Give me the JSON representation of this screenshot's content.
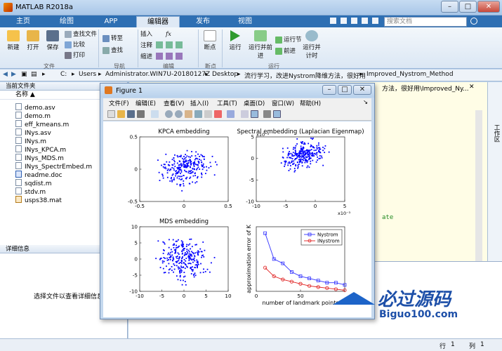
{
  "window": {
    "title": "MATLAB R2018a",
    "buttons": [
      "–",
      "□",
      "✕"
    ]
  },
  "ribbon": {
    "tabs": [
      "主页",
      "绘图",
      "APP",
      "编辑器",
      "发布",
      "视图"
    ],
    "active_tab": "编辑器",
    "search_placeholder": "搜索文档",
    "file_group": {
      "label": "文件",
      "new": "新建",
      "open": "打开",
      "save": "保存",
      "find_files": "查找文件",
      "compare": "比较",
      "print": "打印"
    },
    "nav_group": {
      "label": "导航",
      "goto": "转至",
      "find": "查找"
    },
    "edit_group": {
      "label": "编辑",
      "insert": "插入",
      "comment": "注释",
      "indent": "缩进",
      "fx": "fx"
    },
    "breakpoint_group": {
      "label": "断点",
      "breakpoints": "断点"
    },
    "run_group": {
      "label": "运行",
      "run": "运行",
      "run_advance": "运行并前进",
      "run_section": "运行节",
      "advance": "前进",
      "run_time": "运行并计时"
    }
  },
  "address": {
    "path": [
      "C:",
      "Users",
      "Administrator.WIN7U-20180127Z",
      "Desktop",
      "流行学习，改进Nystrom降维方法，很好用",
      "Improved_Nystrom_Method"
    ]
  },
  "current_folder": {
    "title": "当前文件夹",
    "column": "名称",
    "files": [
      {
        "name": "demo.asv"
      },
      {
        "name": "demo.m"
      },
      {
        "name": "eff_kmeans.m"
      },
      {
        "name": "INys.asv"
      },
      {
        "name": "INys.m"
      },
      {
        "name": "INys_KPCA.m"
      },
      {
        "name": "INys_MDS.m"
      },
      {
        "name": "INys_SpectrEmbed.m"
      },
      {
        "name": "readme.doc"
      },
      {
        "name": "sqdist.m"
      },
      {
        "name": "stdv.m"
      },
      {
        "name": "usps38.mat"
      }
    ],
    "details_title": "详细信息",
    "details_hint": "选择文件以查看详细信息"
  },
  "editor": {
    "tab_label": "方法，很好用\\Improved_Ny...",
    "side_label": "工作区",
    "code_fragment": "ate"
  },
  "status": {
    "row_label": "行",
    "row": "1",
    "col_label": "列",
    "col": "1"
  },
  "figure": {
    "title": "Figure 1",
    "menu": [
      "文件(F)",
      "编辑(E)",
      "查看(V)",
      "插入(I)",
      "工具(T)",
      "桌面(D)",
      "窗口(W)",
      "帮助(H)"
    ]
  },
  "chart_data": [
    {
      "type": "scatter",
      "title": "KPCA embedding",
      "xlim": [
        -0.5,
        0.5
      ],
      "ylim": [
        -0.5,
        0.5
      ],
      "xticks": [
        "-0.5",
        "0",
        "0.5"
      ],
      "yticks": [
        "0.5",
        "0",
        "-0.5"
      ],
      "color": "#0000ff"
    },
    {
      "type": "scatter",
      "title": "Spectral embedding (Laplacian Eigenmap)",
      "xlim": [
        -10,
        5
      ],
      "ylim": [
        -10,
        5
      ],
      "xticks": [
        "-10",
        "-5",
        "0",
        "5"
      ],
      "yticks": [
        "5",
        "0",
        "-5",
        "-10"
      ],
      "x_exponent": "x10⁻³",
      "y_exponent": "x10⁻³",
      "color": "#0000ff"
    },
    {
      "type": "scatter",
      "title": "MDS embedding",
      "xlim": [
        -10,
        10
      ],
      "ylim": [
        -10,
        10
      ],
      "xticks": [
        "-10",
        "-5",
        "0",
        "5",
        "10"
      ],
      "yticks": [
        "10",
        "5",
        "0",
        "-5",
        "-10"
      ],
      "color": "#0000ff"
    },
    {
      "type": "line",
      "xlabel": "number of landmark points",
      "ylabel": "approximation error of K",
      "xlim": [
        0,
        100
      ],
      "xticks": [
        "0",
        "50"
      ],
      "x": [
        10,
        20,
        30,
        40,
        50,
        60,
        70,
        80,
        90,
        100
      ],
      "series": [
        {
          "name": "Nystrom",
          "color": "#3333ff",
          "marker": "square",
          "values": [
            37,
            25,
            23,
            19,
            17,
            16,
            15,
            14,
            14,
            13
          ]
        },
        {
          "name": "INystrom",
          "color": "#e02020",
          "marker": "circle",
          "values": [
            21,
            17,
            15.5,
            14.5,
            13.5,
            12.5,
            12,
            11.5,
            11,
            10.5
          ]
        }
      ],
      "ylim": [
        10,
        40
      ],
      "legend": "top-right"
    }
  ],
  "watermark": {
    "main": "必过源码",
    "sub": "Biguo100.com"
  }
}
